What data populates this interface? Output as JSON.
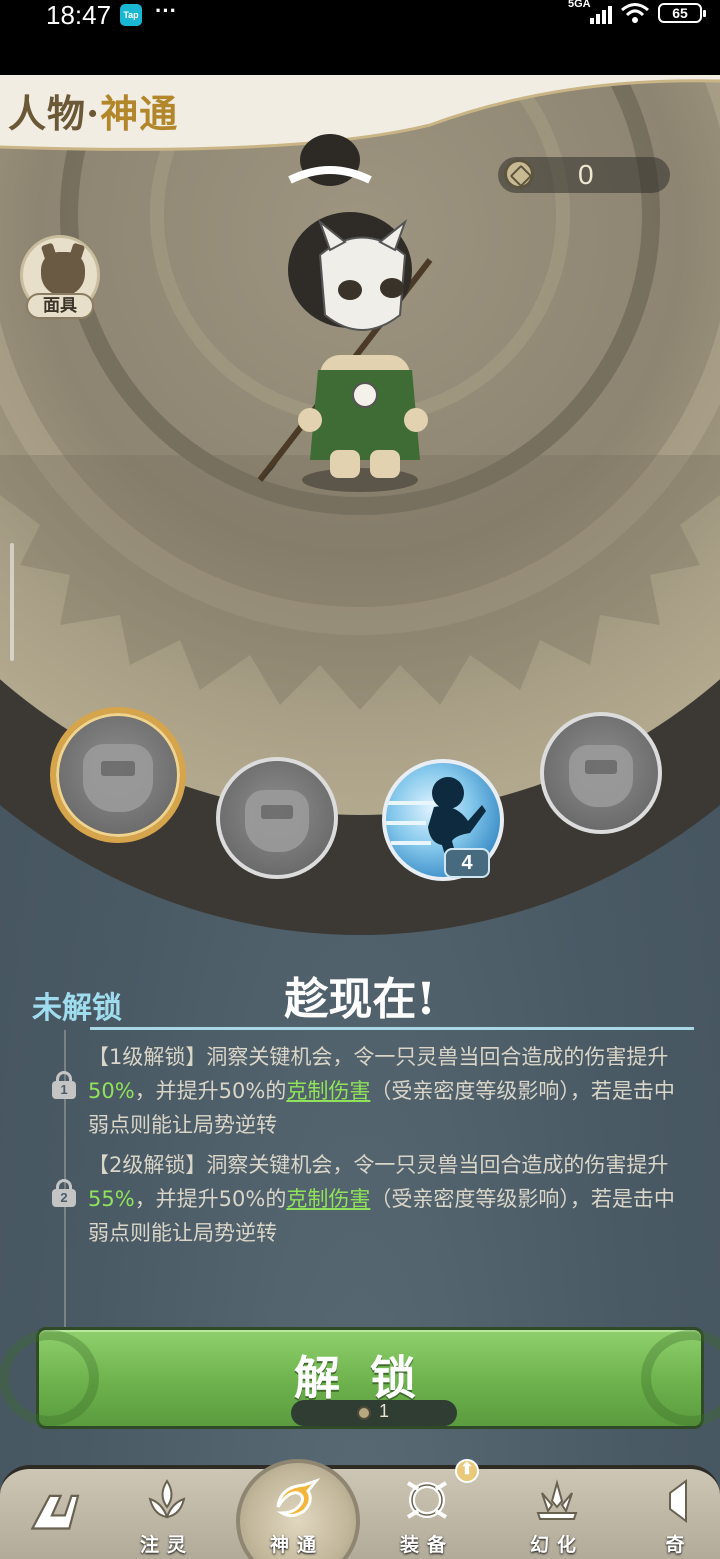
{
  "status_bar": {
    "time": "18:47",
    "app_icon": "Tap",
    "more": "···",
    "network": "5GA",
    "battery": "65"
  },
  "header": {
    "title_part1": "人物·",
    "title_part2": "神通"
  },
  "currency": {
    "icon": "coin-icon",
    "value": "0"
  },
  "mask_button": {
    "label": "面具"
  },
  "skill_slots": [
    {
      "state": "locked",
      "selected": true
    },
    {
      "state": "locked",
      "selected": false
    },
    {
      "state": "active",
      "badge": "4"
    },
    {
      "state": "locked",
      "selected": false
    }
  ],
  "skill_panel": {
    "status": "未解锁",
    "title": "趁现在!",
    "levels": [
      {
        "lock_num": "1",
        "prefix": "【1级解锁】洞察关键机会，令一只灵兽当回合造成的伤害提升",
        "value": "50%",
        "mid": "，并提升50%的",
        "link": "克制伤害",
        "suffix": "（受亲密度等级影响），若是击中弱点则能让局势逆转"
      },
      {
        "lock_num": "2",
        "prefix": "【2级解锁】洞察关键机会，令一只灵兽当回合造成的伤害提升",
        "value": "55%",
        "mid": "，并提升50%的",
        "link": "克制伤害",
        "suffix": "（受亲密度等级影响），若是击中弱点则能让局势逆转"
      }
    ]
  },
  "unlock_button": {
    "label": "解锁",
    "cost": "1"
  },
  "nav": {
    "items": [
      {
        "label": "",
        "icon": "back-logo-icon"
      },
      {
        "label": "注灵",
        "icon": "lotus-flame-icon"
      },
      {
        "label": "神通",
        "icon": "swirl-icon",
        "active": true
      },
      {
        "label": "装备",
        "icon": "shield-ring-icon",
        "badge": "⬆"
      },
      {
        "label": "幻化",
        "icon": "lotus-icon"
      },
      {
        "label": "奇",
        "icon": "drum-icon"
      }
    ]
  },
  "colors": {
    "accent_green": "#8fe25a",
    "status_blue": "#9fdcee",
    "title_gold": "#b2872c",
    "button_green": "#6db24d"
  }
}
